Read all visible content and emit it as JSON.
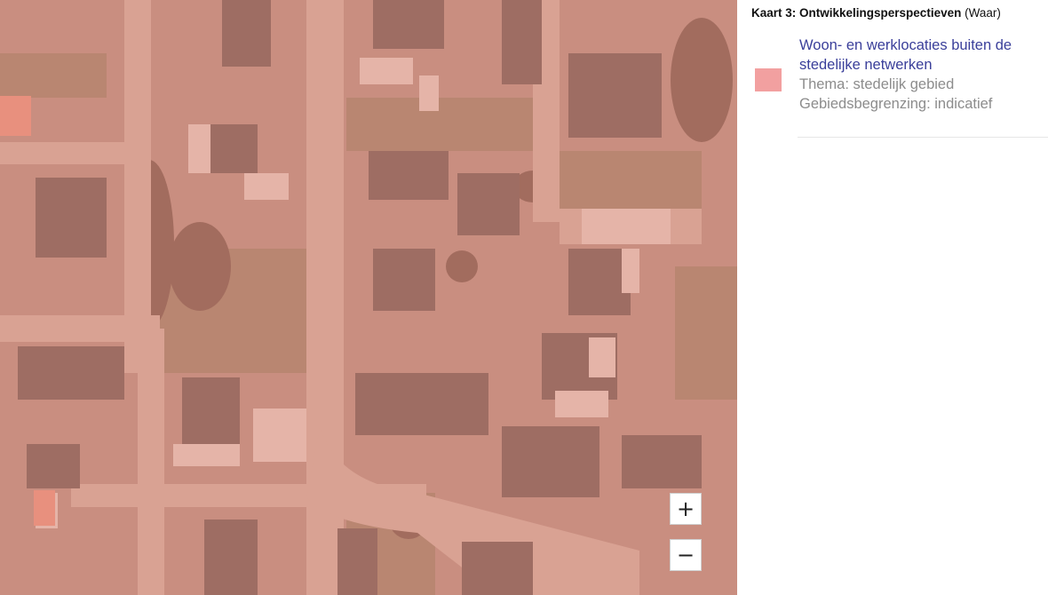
{
  "map": {
    "zoom_in_label": "+",
    "zoom_out_label": "−",
    "overlay_color": "#f2a0a0",
    "background_color": "#c98e80"
  },
  "legend": {
    "title_strong": "Kaart 3: Ontwikkelingsperspectieven",
    "title_suffix": "(Waar)",
    "entry": {
      "title": "Woon- en werklocaties buiten de stedelijke netwerken",
      "theme": "Thema: stedelijk gebied",
      "boundary": "Gebiedsbegrenzing: indicatief",
      "swatch_color": "#f2a0a0"
    }
  }
}
